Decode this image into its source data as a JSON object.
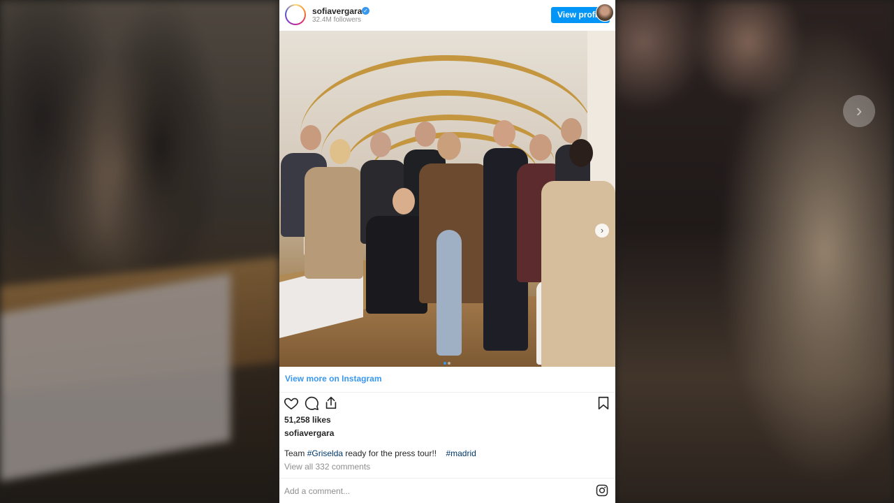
{
  "embed": {
    "username": "sofiavergara",
    "followers": "32.4M followers",
    "view_profile_label": "View profile",
    "view_more_label": "View more on Instagram",
    "likes": "51,258 likes",
    "caption_user": "sofiavergara",
    "caption_prefix": "Team ",
    "hashtag1": "#Griselda",
    "caption_middle": " ready for the press tour!!    ",
    "hashtag2": "#madrid",
    "comments_link": "View all 332 comments",
    "comment_placeholder": "Add a comment..."
  },
  "icons": {
    "like": "heart-icon",
    "comment": "comment-icon",
    "share": "share-icon",
    "save": "bookmark-icon",
    "instagram": "instagram-logo-icon",
    "verified": "verified-badge-icon",
    "next": "chevron-right-icon"
  },
  "colors": {
    "accent": "#3897f0",
    "button": "#0095f6",
    "text": "#262626",
    "muted": "#8e8e8e",
    "hashtag": "#00376b"
  },
  "carousel": {
    "slides": 2,
    "active_slide": 1
  }
}
